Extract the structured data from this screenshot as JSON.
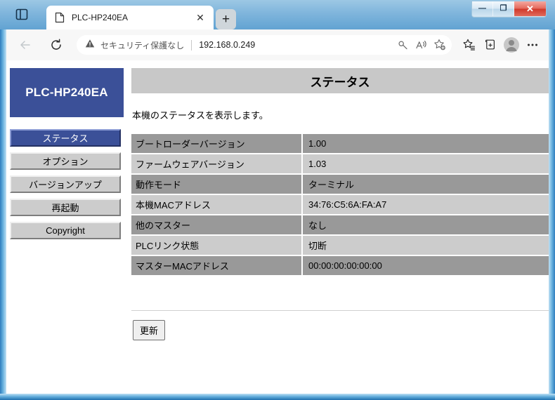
{
  "window": {
    "caption_buttons": [
      {
        "name": "minimize",
        "glyph": "—"
      },
      {
        "name": "maximize",
        "glyph": "❐"
      },
      {
        "name": "close",
        "glyph": "✕"
      }
    ]
  },
  "browser": {
    "tabstrip_icon": "tab-actions-icon",
    "tab": {
      "favicon": "page-icon",
      "title": "PLC-HP240EA",
      "close_glyph": "✕"
    },
    "newtab_label": "+",
    "back_icon": "back-arrow-icon",
    "refresh_icon": "refresh-icon",
    "omnibox": {
      "warning_icon": "warning-triangle-icon",
      "security_text": "セキュリティ保護なし",
      "url": "192.168.0.249",
      "inline_icons": [
        "key-icon",
        "read-aloud-icon",
        "add-favorite-icon"
      ]
    },
    "toolbar_icons": [
      "favorites-icon",
      "collections-icon",
      "profile-icon",
      "settings-more-icon"
    ]
  },
  "page": {
    "brand": "PLC-HP240EA",
    "nav": [
      {
        "label": "ステータス",
        "active": true
      },
      {
        "label": "オプション",
        "active": false
      },
      {
        "label": "バージョンアップ",
        "active": false
      },
      {
        "label": "再起動",
        "active": false
      },
      {
        "label": "Copyright",
        "active": false
      }
    ],
    "title": "ステータス",
    "description": "本機のステータスを表示します。",
    "table": {
      "rows": [
        {
          "key": "ブートローダーバージョン",
          "value": "1.00"
        },
        {
          "key": "ファームウェアバージョン",
          "value": "1.03"
        },
        {
          "key": "動作モード",
          "value": "ターミナル"
        },
        {
          "key": "本機MACアドレス",
          "value": "34:76:C5:6A:FA:A7"
        },
        {
          "key": "他のマスター",
          "value": "なし"
        },
        {
          "key": "PLCリンク状態",
          "value": "切断"
        },
        {
          "key": "マスターMACアドレス",
          "value": "00:00:00:00:00:00"
        }
      ]
    },
    "refresh_button": "更新"
  },
  "colors": {
    "brand_blue": "#3b5098",
    "row_dark": "#999999",
    "row_light": "#cccccc",
    "title_band": "#c8c8c8"
  }
}
